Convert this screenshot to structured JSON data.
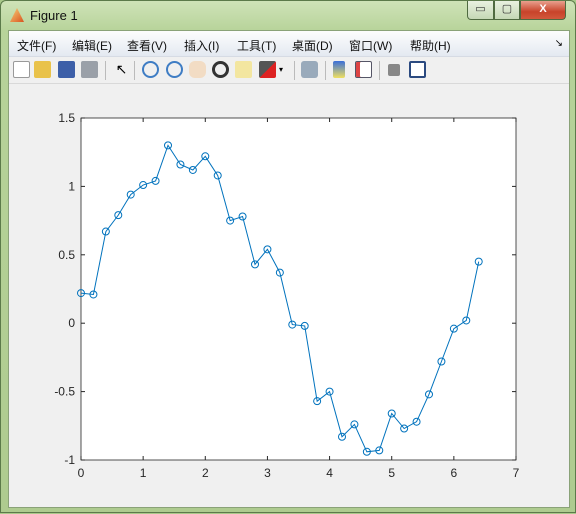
{
  "window": {
    "title": "Figure 1",
    "min_label": "▭",
    "max_label": "▢",
    "close_label": "X"
  },
  "menu": [
    "文件(F)",
    "编辑(E)",
    "查看(V)",
    "插入(I)",
    "工具(T)",
    "桌面(D)",
    "窗口(W)",
    "帮助(H)"
  ],
  "menu_overflow": "↘",
  "toolbar": [
    "new-figure-icon",
    "open-file-icon",
    "save-icon",
    "print-icon",
    "edit-plot-arrow-icon",
    "zoom-in-icon",
    "zoom-out-icon",
    "pan-hand-icon",
    "rotate-3d-icon",
    "data-cursor-icon",
    "brush-icon",
    "brush-dropdown-icon",
    "link-plot-icon",
    "colorbar-icon",
    "legend-icon",
    "hide-plot-tools-icon",
    "show-plot-tools-icon"
  ],
  "chart_data": {
    "type": "line",
    "marker": "circle",
    "color": "#0072bd",
    "x": [
      0,
      0.2,
      0.4,
      0.6,
      0.8,
      1.0,
      1.2,
      1.4,
      1.6,
      1.8,
      2.0,
      2.2,
      2.4,
      2.6,
      2.8,
      3.0,
      3.2,
      3.4,
      3.6,
      3.8,
      4.0,
      4.2,
      4.4,
      4.6,
      4.8,
      5.0,
      5.2,
      5.4,
      5.6,
      5.8,
      6.0,
      6.2,
      6.4
    ],
    "y": [
      0.22,
      0.21,
      0.67,
      0.79,
      0.94,
      1.01,
      1.04,
      1.3,
      1.16,
      1.12,
      1.22,
      1.08,
      0.75,
      0.78,
      0.43,
      0.54,
      0.37,
      -0.01,
      -0.02,
      -0.57,
      -0.5,
      -0.83,
      -0.74,
      -0.94,
      -0.93,
      -0.66,
      -0.77,
      -0.72,
      -0.52,
      -0.28,
      -0.04,
      0.02,
      0.45
    ],
    "xlim": [
      0,
      7
    ],
    "ylim": [
      -1,
      1.5
    ],
    "xticks": [
      "0",
      "1",
      "2",
      "3",
      "4",
      "5",
      "6",
      "7"
    ],
    "yticks": [
      "-1",
      "-0.5",
      "0",
      "0.5",
      "1",
      "1.5"
    ],
    "grid": false
  }
}
